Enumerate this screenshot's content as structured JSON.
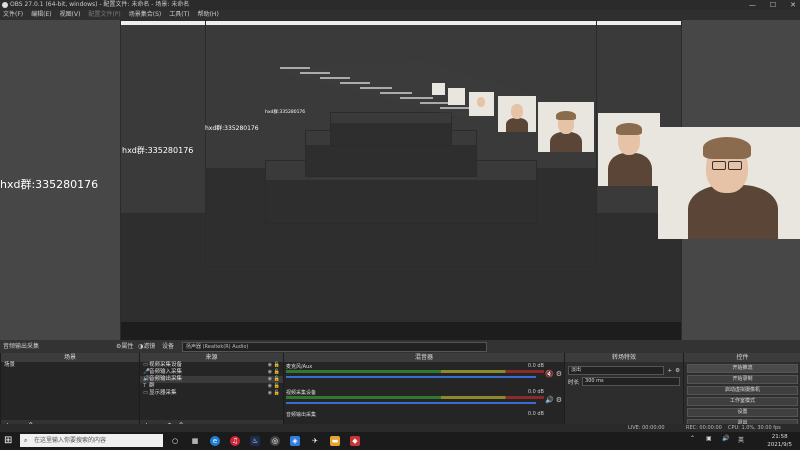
{
  "window": {
    "title": "OBS 27.0.1 (64-bit, windows) - 配置文件: 未命名 - 场景: 未命名",
    "controls": [
      "—",
      "☐",
      "✕"
    ]
  },
  "menu": [
    "文件(F)",
    "编辑(E)",
    "视图(V)",
    "配置文件(P)",
    "场景集合(S)",
    "工具(T)",
    "帮助(H)"
  ],
  "preview": {
    "watermark": "hxd群:335280176"
  },
  "dock_header": {
    "scene_source": "音频输出采集",
    "properties_label": "属性",
    "filters_label": "滤镜",
    "device_label": "设备",
    "device_value": "扬声器 (Realtek(R) Audio)"
  },
  "scenes": {
    "title": "场景",
    "items": [
      "场景"
    ]
  },
  "sources": {
    "title": "来源",
    "items": [
      {
        "icon": "▭",
        "name": "视频采集设备"
      },
      {
        "icon": "🎤",
        "name": "音频输入采集"
      },
      {
        "icon": "🔊",
        "name": "音频输出采集"
      },
      {
        "icon": "T",
        "name": "群"
      },
      {
        "icon": "▭",
        "name": "显示器采集"
      }
    ]
  },
  "mixer": {
    "title": "混音器",
    "tracks": [
      {
        "name": "麦克风/Aux",
        "db": "0.0 dB"
      },
      {
        "name": "视频采集设备",
        "db": "0.0 dB"
      },
      {
        "name": "音频输出采集",
        "db": "0.0 dB"
      }
    ]
  },
  "transitions": {
    "title": "转场特效",
    "type": "淡出",
    "duration_label": "时长",
    "duration_value": "300 ms"
  },
  "controls": {
    "title": "控件",
    "buttons": [
      "开始推流",
      "开始录制",
      "启动虚拟摄像机",
      "工作室模式",
      "设置",
      "退出"
    ]
  },
  "status": {
    "live": "LIVE: 00:00:00",
    "rec": "REC: 00:00:00",
    "cpu": "CPU: 1.0%, 30.00 fps"
  },
  "taskbar": {
    "search_placeholder": "在这里输入你要搜索的内容",
    "time": "21:58",
    "date": "2021/9/5"
  }
}
